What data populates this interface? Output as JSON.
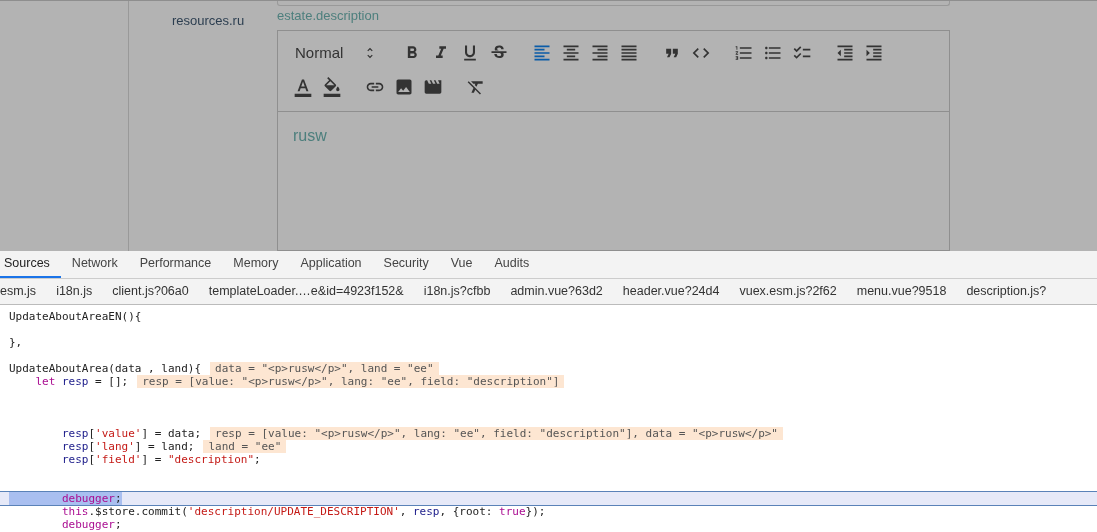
{
  "page": {
    "label": "resources.ru",
    "field_caption": "estate.description",
    "editor": {
      "toolbar_rows": [
        [
          [
            {
              "kind": "header",
              "label": "Normal",
              "active": false
            }
          ],
          [
            {
              "kind": "bold",
              "active": false
            },
            {
              "kind": "italic",
              "active": false
            },
            {
              "kind": "underline",
              "active": false
            },
            {
              "kind": "strike",
              "active": false
            }
          ],
          [
            {
              "kind": "align-left",
              "active": true
            },
            {
              "kind": "align-center",
              "active": false
            },
            {
              "kind": "align-right",
              "active": false
            },
            {
              "kind": "justify",
              "active": false
            }
          ],
          [
            {
              "kind": "blockquote",
              "active": false
            },
            {
              "kind": "code-block",
              "active": false
            }
          ],
          [
            {
              "kind": "ordered-list",
              "active": false
            },
            {
              "kind": "bullet-list",
              "active": false
            },
            {
              "kind": "check-list",
              "active": false
            }
          ],
          [
            {
              "kind": "outdent",
              "active": false
            },
            {
              "kind": "indent",
              "active": false
            }
          ]
        ],
        [
          [
            {
              "kind": "text-color",
              "active": false
            },
            {
              "kind": "background",
              "active": false
            }
          ],
          [
            {
              "kind": "link",
              "active": false
            },
            {
              "kind": "image",
              "active": false
            },
            {
              "kind": "video",
              "active": false
            }
          ],
          [
            {
              "kind": "clean",
              "active": false
            }
          ]
        ]
      ],
      "content": "rusw"
    }
  },
  "devtools": {
    "tabs": [
      {
        "label": "Sources",
        "selected": true
      },
      {
        "label": "Network",
        "selected": false
      },
      {
        "label": "Performance",
        "selected": false
      },
      {
        "label": "Memory",
        "selected": false
      },
      {
        "label": "Application",
        "selected": false
      },
      {
        "label": "Security",
        "selected": false
      },
      {
        "label": "Vue",
        "selected": false
      },
      {
        "label": "Audits",
        "selected": false
      }
    ],
    "files": [
      "esm.js",
      "i18n.js",
      "client.js?06a0",
      "templateLoader.…e&id=4923f152&",
      "i18n.js?cfbb",
      "admin.vue?63d2",
      "header.vue?24d4",
      "vuex.esm.js?2f62",
      "menu.vue?9518",
      "description.js?"
    ],
    "code_lines": [
      {
        "kind": "code",
        "current": false,
        "tokens": [
          {
            "text": "UpdateAboutAreaEN(){",
            "kind": "plain"
          }
        ]
      },
      {
        "kind": "blank"
      },
      {
        "kind": "code",
        "current": false,
        "tokens": [
          {
            "text": "},",
            "kind": "plain"
          }
        ]
      },
      {
        "kind": "blank"
      },
      {
        "kind": "code",
        "current": false,
        "tokens": [
          {
            "text": "UpdateAboutArea(data , land){",
            "kind": "plain"
          }
        ],
        "inline_value": "data = \"<p>rusw</p>\", land = \"ee\""
      },
      {
        "kind": "code",
        "current": false,
        "tokens": [
          {
            "text": "    let",
            "kind": "keyword"
          },
          {
            "text": " resp",
            "kind": "variable"
          },
          {
            "text": " = [];",
            "kind": "plain"
          }
        ],
        "inline_value": "resp = [value: \"<p>rusw</p>\", lang: \"ee\", field: \"description\"]"
      },
      {
        "kind": "blank"
      },
      {
        "kind": "blank"
      },
      {
        "kind": "blank"
      },
      {
        "kind": "code",
        "current": false,
        "tokens": [
          {
            "text": "        resp",
            "kind": "variable"
          },
          {
            "text": "[",
            "kind": "plain"
          },
          {
            "text": "'value'",
            "kind": "string"
          },
          {
            "text": "] = data;",
            "kind": "plain"
          }
        ],
        "inline_value": "resp = [value: \"<p>rusw</p>\", lang: \"ee\", field: \"description\"], data = \"<p>rusw</p>\""
      },
      {
        "kind": "code",
        "current": false,
        "tokens": [
          {
            "text": "        resp",
            "kind": "variable"
          },
          {
            "text": "[",
            "kind": "plain"
          },
          {
            "text": "'lang'",
            "kind": "string"
          },
          {
            "text": "] = land;",
            "kind": "plain"
          }
        ],
        "inline_value": "land = \"ee\""
      },
      {
        "kind": "code",
        "current": false,
        "tokens": [
          {
            "text": "        resp",
            "kind": "variable"
          },
          {
            "text": "[",
            "kind": "plain"
          },
          {
            "text": "'field'",
            "kind": "string"
          },
          {
            "text": "] = ",
            "kind": "plain"
          },
          {
            "text": "\"description\"",
            "kind": "string"
          },
          {
            "text": ";",
            "kind": "plain"
          }
        ]
      },
      {
        "kind": "blank"
      },
      {
        "kind": "blank"
      },
      {
        "kind": "code",
        "current": true,
        "tokens": [
          {
            "text": "        debugger",
            "kind": "keyword"
          },
          {
            "text": ";",
            "kind": "plain"
          }
        ]
      },
      {
        "kind": "code",
        "current": false,
        "tokens": [
          {
            "text": "        this",
            "kind": "keyword"
          },
          {
            "text": ".$store.commit(",
            "kind": "plain"
          },
          {
            "text": "'description/UPDATE_DESCRIPTION'",
            "kind": "string"
          },
          {
            "text": ", ",
            "kind": "plain"
          },
          {
            "text": "resp",
            "kind": "variable"
          },
          {
            "text": ", {root: ",
            "kind": "plain"
          },
          {
            "text": "true",
            "kind": "keyword"
          },
          {
            "text": "});",
            "kind": "plain"
          }
        ]
      },
      {
        "kind": "code",
        "current": false,
        "tokens": [
          {
            "text": "        debugger",
            "kind": "keyword"
          },
          {
            "text": ";",
            "kind": "plain"
          }
        ]
      }
    ]
  }
}
